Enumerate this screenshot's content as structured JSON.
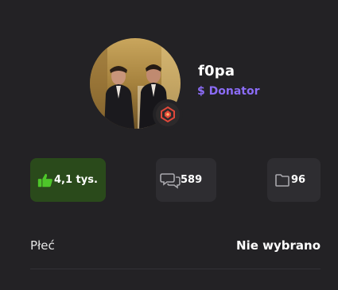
{
  "profile": {
    "username": "f0pa",
    "role": "$ Donator",
    "colors": {
      "role": "#8b6cf6",
      "likes_bg": "#2a4a1b",
      "likes_icon": "#4ec62a",
      "badge": "#e0483a"
    }
  },
  "stats": {
    "likes": {
      "value": "4,1 tys.",
      "icon": "thumbs-up-icon"
    },
    "posts": {
      "value": "589",
      "icon": "chat-bubbles-icon"
    },
    "files": {
      "value": "96",
      "icon": "folder-icon"
    }
  },
  "fields": [
    {
      "label": "Płeć",
      "value": "Nie wybrano"
    }
  ]
}
